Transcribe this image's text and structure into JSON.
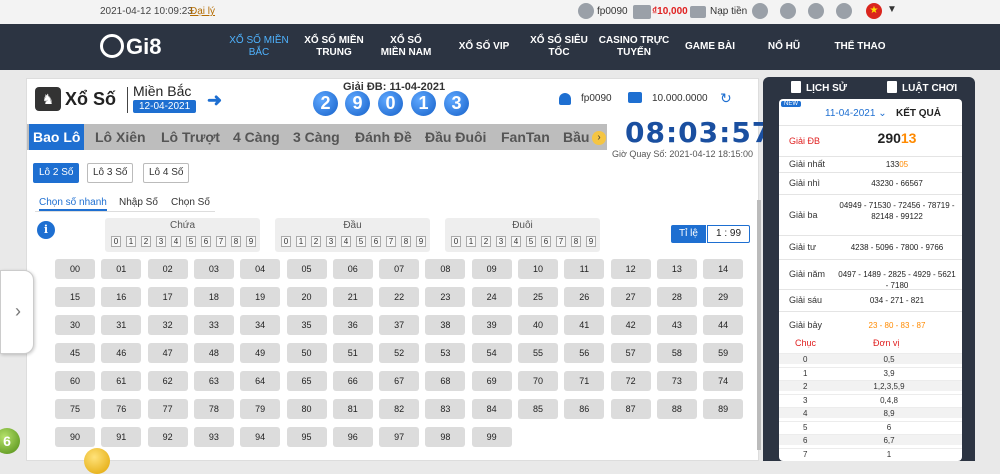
{
  "topbar": {
    "datetime": "2021-04-12 10:09:23",
    "agent_link": "Đại lý",
    "username": "fp0090",
    "balance": "₫10,000",
    "deposit": "Nạp tiền"
  },
  "nav": {
    "logo": "Gi8",
    "items": [
      {
        "label": "XỔ SỐ MIỀN BẮC",
        "active": true
      },
      {
        "label": "XỔ SỐ MIỀN TRUNG"
      },
      {
        "label": "XỔ SỐ MIỀN NAM"
      },
      {
        "label": "XỔ SỐ VIP"
      },
      {
        "label": "XỔ SỐ SIÊU TỐC"
      },
      {
        "label": "CASINO TRỰC TUYẾN"
      },
      {
        "label": "GAME BÀI"
      },
      {
        "label": "NỔ HŨ"
      },
      {
        "label": "THỂ THAO"
      }
    ]
  },
  "header": {
    "title": "Xổ Số",
    "region": "Miền Bắc",
    "date": "12-04-2021",
    "special_label": "Giải ĐB: 11-04-2021",
    "special_digits": [
      "2",
      "9",
      "0",
      "1",
      "3"
    ],
    "username": "fp0090",
    "wallet": "10.000.0000"
  },
  "tabs": [
    "Bao Lô",
    "Lô Xiên",
    "Lô Trượt",
    "4 Càng",
    "3 Càng",
    "Đánh Đề",
    "Đầu Đuôi",
    "FanTan",
    "Bầu"
  ],
  "clock": {
    "time": "08:03:57",
    "next_draw": "Giờ Quay Số: 2021-04-12 18:15:00"
  },
  "subtabs": [
    "Lô 2 Số",
    "Lô 3 Số",
    "Lô 4 Số"
  ],
  "modes": [
    "Chọn số nhanh",
    "Nhập Số",
    "Chọn Số"
  ],
  "filters": {
    "groups": [
      "Chứa",
      "Đầu",
      "Đuôi"
    ],
    "digits": [
      "0",
      "1",
      "2",
      "3",
      "4",
      "5",
      "6",
      "7",
      "8",
      "9"
    ]
  },
  "rate": {
    "label": "Tỉ lệ",
    "value": "1 : 99"
  },
  "numbers": [
    "00",
    "01",
    "02",
    "03",
    "04",
    "05",
    "06",
    "07",
    "08",
    "09",
    "10",
    "11",
    "12",
    "13",
    "14",
    "15",
    "16",
    "17",
    "18",
    "19",
    "20",
    "21",
    "22",
    "23",
    "24",
    "25",
    "26",
    "27",
    "28",
    "29",
    "30",
    "31",
    "32",
    "33",
    "34",
    "35",
    "36",
    "37",
    "38",
    "39",
    "40",
    "41",
    "42",
    "43",
    "44",
    "45",
    "46",
    "47",
    "48",
    "49",
    "50",
    "51",
    "52",
    "53",
    "54",
    "55",
    "56",
    "57",
    "58",
    "59",
    "60",
    "61",
    "62",
    "63",
    "64",
    "65",
    "66",
    "67",
    "68",
    "69",
    "70",
    "71",
    "72",
    "73",
    "74",
    "75",
    "76",
    "77",
    "78",
    "79",
    "80",
    "81",
    "82",
    "83",
    "84",
    "85",
    "86",
    "87",
    "88",
    "89",
    "90",
    "91",
    "92",
    "93",
    "94",
    "95",
    "96",
    "97",
    "98",
    "99"
  ],
  "results_panel": {
    "history": "LỊCH SỬ",
    "rules": "LUẬT CHƠI",
    "new_badge": "NEW",
    "date": "11-04-2021 ⌄",
    "heading": "KẾT QUẢ",
    "prizes": [
      {
        "name": "Giải ĐB",
        "value_plain": "290",
        "value_hl": "13"
      },
      {
        "name": "Giải nhất",
        "value_plain": "133",
        "value_hl": "05"
      },
      {
        "name": "Giải nhì",
        "value_plain": "43230 - 66567",
        "value_hl": ""
      },
      {
        "name": "Giải ba",
        "value_plain": "04949 - 71530 - 72456 - 78719 - 82148 - 99122",
        "value_hl": ""
      },
      {
        "name": "Giải tư",
        "value_plain": "4238 - 5096 - 7800 - 9766",
        "value_hl": ""
      },
      {
        "name": "Giải năm",
        "value_plain": "0497 - 1489 - 2825 - 4929 - 5621 - 7180",
        "value_hl": ""
      },
      {
        "name": "Giải sáu",
        "value_plain": "034 - 271 - 821",
        "value_hl": ""
      },
      {
        "name": "Giải bảy",
        "value_plain": "",
        "value_hl": "23 - 80 - 83 - 87"
      }
    ],
    "table_headers": [
      "Chục",
      "Đơn vị"
    ],
    "table_rows": [
      {
        "c": "0",
        "v": "0,5"
      },
      {
        "c": "1",
        "v": "3,9"
      },
      {
        "c": "2",
        "v": "1,2,3,5,9"
      },
      {
        "c": "3",
        "v": "0,4,8"
      },
      {
        "c": "4",
        "v": "8,9"
      },
      {
        "c": "5",
        "v": "6"
      },
      {
        "c": "6",
        "v": "6,7"
      },
      {
        "c": "7",
        "v": "1"
      }
    ]
  },
  "floating_ball": "6"
}
